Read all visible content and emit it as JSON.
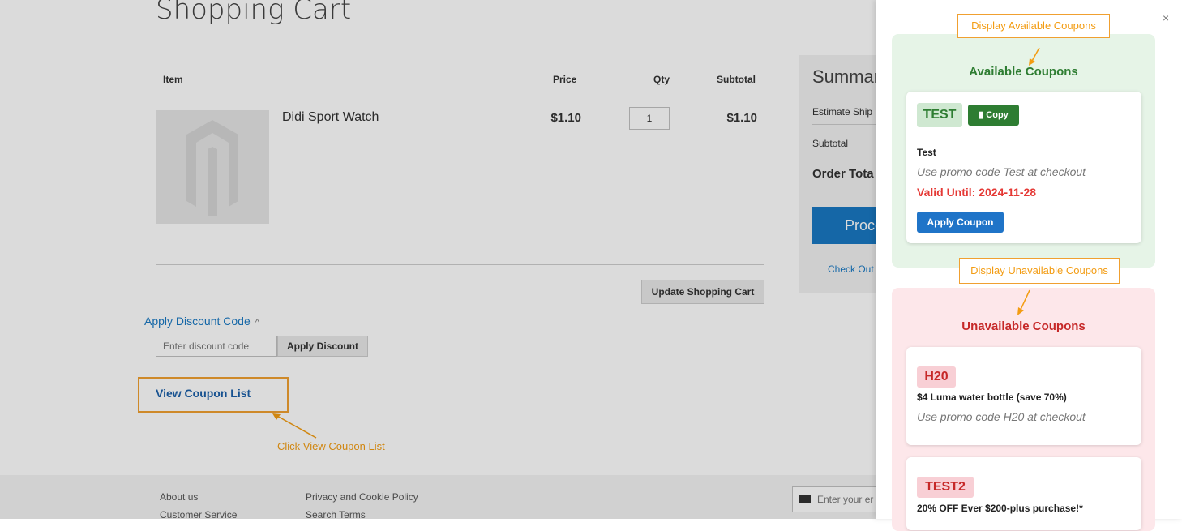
{
  "page": {
    "title": "Shopping Cart",
    "table": {
      "headers": [
        "Item",
        "Price",
        "Qty",
        "Subtotal"
      ],
      "rows": [
        {
          "name": "Didi Sport Watch",
          "price": "$1.10",
          "qty": "1",
          "subtotal": "$1.10"
        }
      ]
    },
    "update_button": "Update Shopping Cart",
    "discount": {
      "toggle_label": "Apply Discount Code",
      "chevron": "^",
      "input_placeholder": "Enter discount code",
      "apply_button": "Apply Discount"
    },
    "view_coupon_link": "View Coupon List"
  },
  "summary": {
    "title": "Summar",
    "estimate": "Estimate Ship",
    "subtotal_label": "Subtotal",
    "order_total": "Order Tota",
    "proceed": "Proce",
    "checkout_link": "Check Out"
  },
  "footer": {
    "links": [
      "About us",
      "Customer Service",
      "Privacy and Cookie Policy",
      "Search Terms"
    ],
    "newsletter_placeholder": "Enter your er"
  },
  "annotations": {
    "click_view": "Click View Coupon List",
    "display_available": "Display Available Coupons",
    "display_unavailable": "Display Unavailable Coupons",
    "color": "#f39c12"
  },
  "coupon_panel": {
    "close": "×",
    "available": {
      "title": "Available Coupons",
      "coupons": [
        {
          "code": "TEST",
          "copy_label": "Copy",
          "name": "Test",
          "description": "Use promo code Test at checkout",
          "valid_until": "Valid Until: 2024-11-28",
          "apply_label": "Apply Coupon"
        }
      ]
    },
    "unavailable": {
      "title": "Unavailable Coupons",
      "coupons": [
        {
          "code": "H20",
          "name": "$4 Luma water bottle (save 70%)",
          "description": "Use promo code H20 at checkout"
        },
        {
          "code": "TEST2",
          "name": "20% OFF Ever $200-plus purchase!*"
        }
      ]
    },
    "colors": {
      "available_bg": "#e6f4e7",
      "available_title": "#2e7d32",
      "unavailable_bg": "#fde7ea",
      "unavailable_title": "#c62828",
      "apply_button": "#1f74c8"
    }
  }
}
